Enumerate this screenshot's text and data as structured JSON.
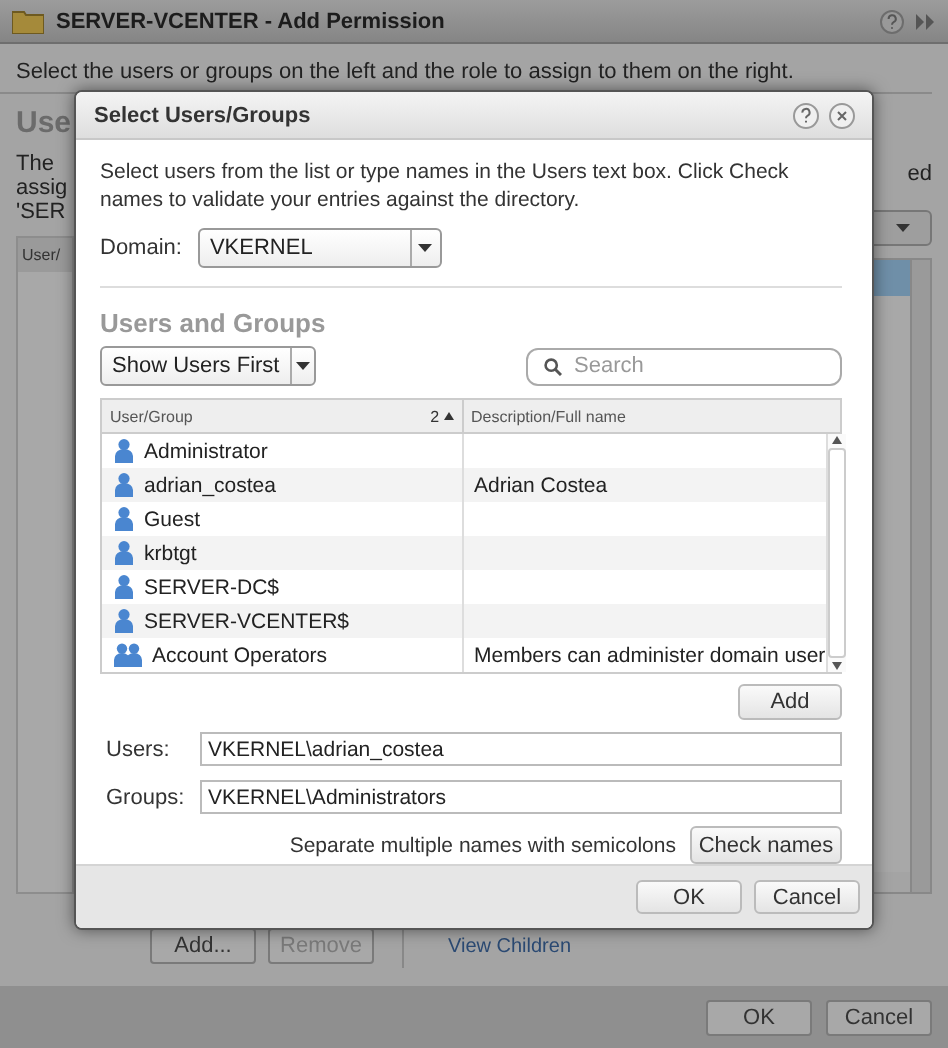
{
  "window": {
    "title": "SERVER-VCENTER - Add Permission",
    "description": "Select the users or groups on the left and the role to assign to them on the right."
  },
  "background": {
    "section_title": "Use",
    "text_lines": [
      "The",
      "assig",
      "'SER"
    ],
    "text_right": "ed",
    "table_header": "User/",
    "role_rows": [
      {
        "selected": true
      },
      {
        "selected": false
      },
      {
        "selected": false
      },
      {
        "selected": false
      },
      {
        "selected": false
      },
      {
        "selected": false
      },
      {
        "selected": false
      },
      {
        "selected": false
      },
      {
        "selected": false
      },
      {
        "selected": false
      },
      {
        "selected": false
      },
      {
        "selected": false
      },
      {
        "selected": false
      },
      {
        "selected": false
      },
      {
        "selected": false
      },
      {
        "selected": false
      },
      {
        "selected": false
      }
    ],
    "buttons": [
      {
        "label": "Add...",
        "disabled": false
      },
      {
        "label": "Remove",
        "disabled": true
      }
    ],
    "link": "View Children",
    "footer_buttons": [
      "OK",
      "Cancel"
    ]
  },
  "dialog": {
    "title": "Select Users/Groups",
    "instructions": "Select users from the list or type names in the Users text box. Click Check names to validate your entries against the directory.",
    "domain": {
      "label": "Domain:",
      "value": "VKERNEL"
    },
    "section_title": "Users and Groups",
    "filter": {
      "value": "Show Users First"
    },
    "search": {
      "placeholder": "Search"
    },
    "table": {
      "columns": [
        {
          "label": "User/Group",
          "sort_badge": "2"
        },
        {
          "label": "Description/Full name"
        }
      ],
      "rows": [
        {
          "kind": "user",
          "name": "Administrator"
        },
        {
          "kind": "user",
          "name": "adrian_costea",
          "description": "Adrian Costea"
        },
        {
          "kind": "user",
          "name": "Guest"
        },
        {
          "kind": "user",
          "name": "krbtgt"
        },
        {
          "kind": "user",
          "name": "SERVER-DC$"
        },
        {
          "kind": "user",
          "name": "SERVER-VCENTER$"
        },
        {
          "kind": "group",
          "name": "Account Operators",
          "description": "Members can administer domain user"
        }
      ]
    },
    "add_button": "Add",
    "users": {
      "label": "Users:",
      "value": "VKERNEL\\adrian_costea"
    },
    "groups": {
      "label": "Groups:",
      "value": "VKERNEL\\Administrators"
    },
    "hint": "Separate multiple names with semicolons",
    "check_button": "Check names",
    "buttons": [
      "OK",
      "Cancel"
    ]
  }
}
